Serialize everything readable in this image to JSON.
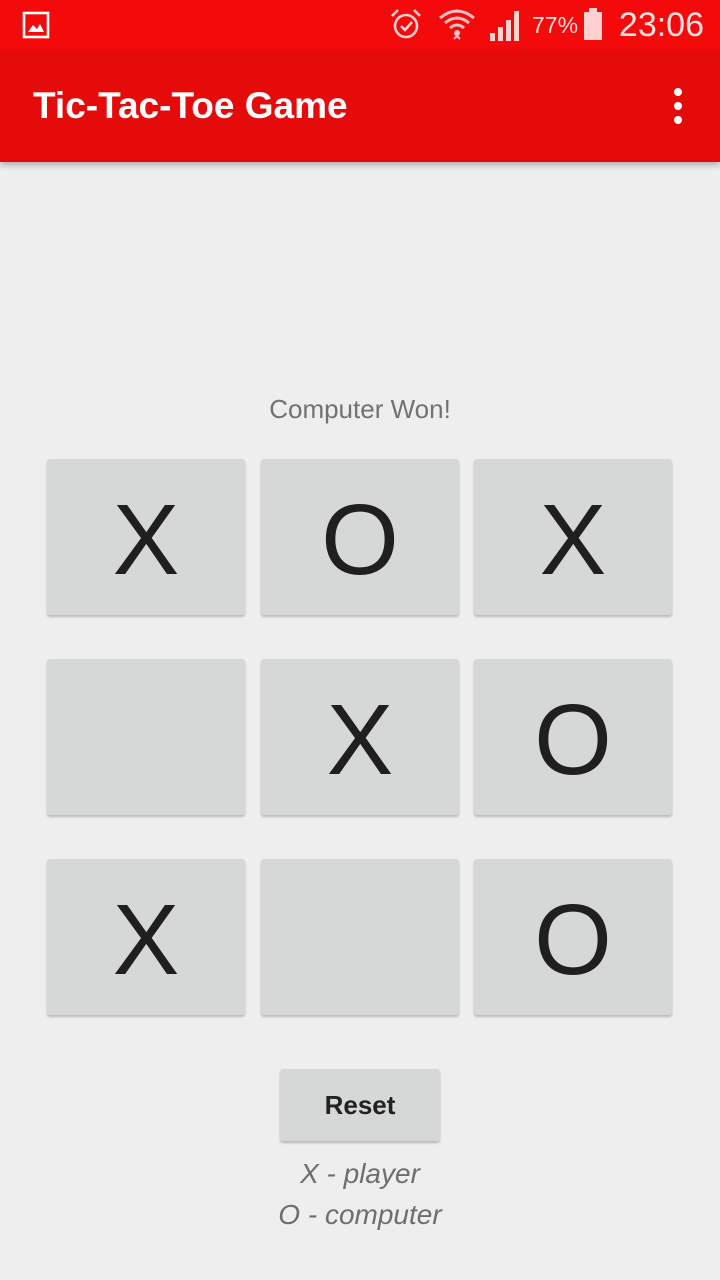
{
  "status_bar": {
    "battery_percent": "77%",
    "time": "23:06",
    "icons": [
      "gallery-icon",
      "alarm-icon",
      "wifi-icon",
      "signal-icon",
      "battery-icon"
    ]
  },
  "app_bar": {
    "title": "Tic-Tac-Toe Game",
    "menu_icon": "overflow-menu-icon"
  },
  "game": {
    "status": "Computer Won!",
    "board": [
      [
        "X",
        "O",
        "X"
      ],
      [
        "",
        "X",
        "O"
      ],
      [
        "X",
        "",
        "O"
      ]
    ]
  },
  "controls": {
    "reset_label": "Reset"
  },
  "legend": {
    "player": "X - player",
    "computer": "O - computer"
  },
  "colors": {
    "status_bar": "#f40a0a",
    "app_bar": "#e60b0b",
    "background": "#eeeeee",
    "cell": "#d6d7d7",
    "mark": "#1f1f1f"
  }
}
